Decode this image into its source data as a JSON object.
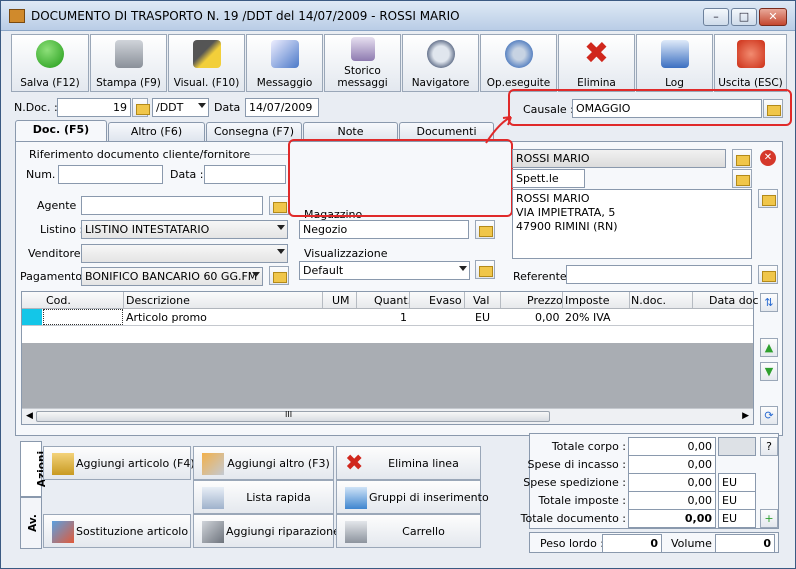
{
  "window": {
    "title": "DOCUMENTO DI TRASPORTO N. 19 /DDT del 14/07/2009 - ROSSI MARIO",
    "controls": [
      "–",
      "□",
      "✕"
    ]
  },
  "toolbar": {
    "save": "Salva (F12)",
    "print": "Stampa (F9)",
    "view": "Visual. (F10)",
    "message": "Messaggio",
    "history_line1": "Storico",
    "history_line2": "messaggi",
    "navigator": "Navigatore",
    "operations": "Op.eseguite",
    "delete": "Elimina",
    "log": "Log",
    "exit": "Uscita (ESC)"
  },
  "header": {
    "ndoc_label": "N.Doc. :",
    "ndoc_value": "19",
    "series_value": "/DDT",
    "date_label": "Data :",
    "date_value": "14/07/2009",
    "causale_label": "Causale :",
    "causale_value": "OMAGGIO"
  },
  "tabs": [
    "Doc. (F5)",
    "Altro (F6)",
    "Consegna (F7)",
    "Note",
    "Documenti"
  ],
  "doc": {
    "ref_group": "Riferimento documento cliente/fornitore",
    "num_label": "Num. :",
    "num_value": "",
    "ref_date_label": "Data :",
    "ref_date_value": "",
    "agent_label": "Agente :",
    "agent_value": "",
    "list_label": "Listino :",
    "list_value": "LISTINO INTESTATARIO",
    "seller_label": "Venditore :",
    "seller_value": "",
    "payment_label": "Pagamento :",
    "payment_value": "BONIFICO BANCARIO 60 GG.FM",
    "warehouse_group": "Magazzino",
    "warehouse_value": "Negozio",
    "display_group": "Visualizzazione",
    "display_value": "Default",
    "customer_name": "ROSSI MARIO",
    "spett_value": "Spett.le",
    "address_line1": "ROSSI MARIO",
    "address_line2": "VIA IMPIETRATA, 5",
    "address_line3": "47900 RIMINI (RN)",
    "referent_label": "Referente",
    "referent_value": ""
  },
  "grid": {
    "columns": [
      "Cod.",
      "Descrizione",
      "UM",
      "Quant.",
      "Evaso",
      "Val",
      "Prezzo",
      "Imposte",
      "N.doc.",
      "Data doc"
    ],
    "rows": [
      {
        "cod": "",
        "descrizione": "Articolo promo",
        "um": "",
        "quant": "1",
        "evaso": "",
        "val": "EU",
        "prezzo": "0,00",
        "imposte": "20% IVA",
        "ndoc": "",
        "datadoc": ""
      }
    ],
    "scroll_grip": "III"
  },
  "actions": {
    "tab_actions": "Azioni",
    "tab_adv": "Av.",
    "add_article": "Aggiungi articolo (F4)",
    "add_other": "Aggiungi altro (F3)",
    "delete_line": "Elimina linea",
    "quick_list": "Lista rapida",
    "insert_groups": "Gruppi di inserimento",
    "replace_article": "Sostituzione articolo",
    "add_repair": "Aggiungi riparazione",
    "cart": "Carrello"
  },
  "totals": {
    "body_label": "Totale corpo :",
    "body_value": "0,00",
    "collection_label": "Spese di incasso :",
    "collection_value": "0,00",
    "shipping_label": "Spese spedizione :",
    "shipping_value": "0,00",
    "shipping_cur": "EU",
    "taxes_label": "Totale imposte :",
    "taxes_value": "0,00",
    "taxes_cur": "EU",
    "doc_label": "Totale documento :",
    "doc_value": "0,00",
    "doc_cur": "EU",
    "help": "?",
    "weight_label": "Peso lordo :",
    "weight_value": "0",
    "volume_label": "Volume :",
    "volume_value": "0"
  }
}
